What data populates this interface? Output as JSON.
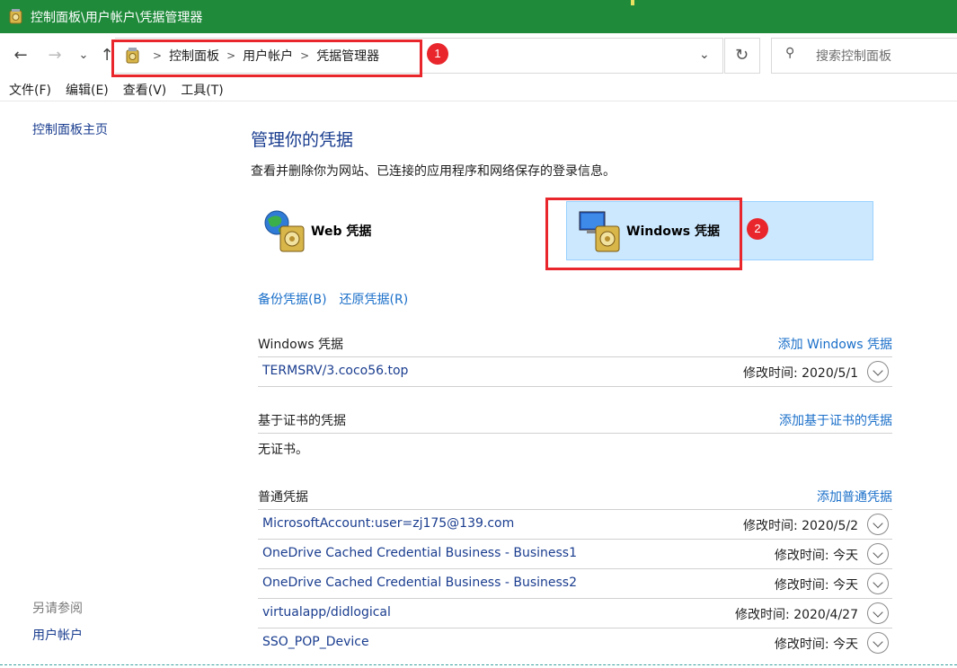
{
  "window": {
    "title": "控制面板\\用户帐户\\凭据管理器"
  },
  "address": {
    "crumbs": [
      "控制面板",
      "用户帐户",
      "凭据管理器"
    ],
    "search_placeholder": "搜索控制面板"
  },
  "annotations": {
    "badge1": "1",
    "badge2": "2"
  },
  "menu": [
    "文件(F)",
    "编辑(E)",
    "查看(V)",
    "工具(T)"
  ],
  "sidebar": {
    "home": "控制面板主页",
    "see_also": "另请参阅",
    "user_accounts": "用户帐户"
  },
  "main": {
    "title": "管理你的凭据",
    "description": "查看并删除你为网站、已连接的应用程序和网络保存的登录信息。",
    "web_tile": "Web 凭据",
    "windows_tile": "Windows 凭据",
    "backup_link": "备份凭据(B)",
    "restore_link": "还原凭据(R)"
  },
  "windows_section": {
    "title": "Windows 凭据",
    "add": "添加 Windows 凭据",
    "items": [
      {
        "name": "TERMSRV/3.coco56.top",
        "date": "修改时间:  2020/5/1"
      }
    ]
  },
  "cert_section": {
    "title": "基于证书的凭据",
    "add": "添加基于证书的凭据",
    "empty": "无证书。"
  },
  "generic_section": {
    "title": "普通凭据",
    "add": "添加普通凭据",
    "items": [
      {
        "name": "MicrosoftAccount:user=zj175@139.com",
        "date": "修改时间:  2020/5/2"
      },
      {
        "name": "OneDrive Cached Credential Business - Business1",
        "date": "修改时间:  今天"
      },
      {
        "name": "OneDrive Cached Credential Business - Business2",
        "date": "修改时间:  今天"
      },
      {
        "name": "virtualapp/didlogical",
        "date": "修改时间:  2020/4/27"
      },
      {
        "name": "SSO_POP_Device",
        "date": "修改时间:  今天"
      }
    ]
  },
  "colors": {
    "titlebar": "#1e8a3a",
    "annotation": "#e8262b",
    "link": "#1a6fc9",
    "selected_tile": "#cce8ff"
  }
}
